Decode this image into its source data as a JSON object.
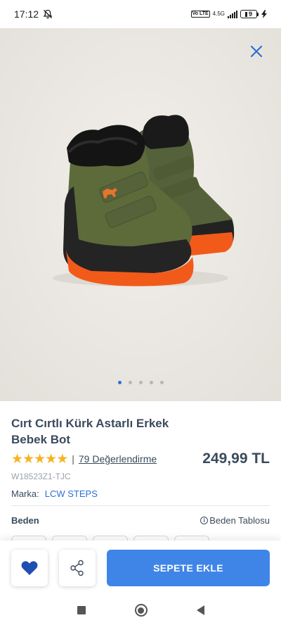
{
  "status_bar": {
    "time": "17:12",
    "network_type": "4.5G",
    "volte_label": "Vo LTE",
    "battery_level": "9"
  },
  "product": {
    "title": "Cırt Cırtlı Kürk Astarlı Erkek Bebek Bot",
    "rating_stars": 5,
    "reviews_label": "79 Değerlendirme",
    "price": "249,99 TL",
    "sku": "W18523Z1-TJC",
    "brand_label": "Marka:",
    "brand_value": "LCW STEPS",
    "image_count": 5,
    "active_image_index": 0
  },
  "size": {
    "label": "Beden",
    "table_link": "Beden Tablosu"
  },
  "actions": {
    "add_to_cart": "SEPETE EKLE"
  },
  "colors": {
    "accent": "#3f85e8",
    "brand_link": "#2f6fd6",
    "star": "#f5b324",
    "hero_bg": "#ebe8e3",
    "boot_olive": "#5b6738",
    "sole_orange": "#f25a1a"
  },
  "icons": [
    "bell-off-icon",
    "signal-icon",
    "battery-icon",
    "charging-icon",
    "close-icon",
    "star-icon",
    "info-icon",
    "heart-icon",
    "share-icon",
    "nav-recents-icon",
    "nav-home-icon",
    "nav-back-icon"
  ]
}
